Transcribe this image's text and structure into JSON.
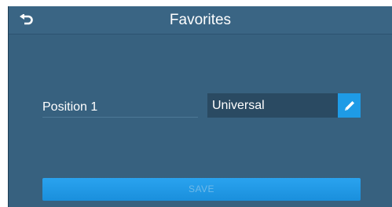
{
  "header": {
    "title": "Favorites",
    "back_icon": "back-arrow-icon"
  },
  "form": {
    "position_label": "Position 1",
    "selected_value": "Universal",
    "edit_icon": "pencil-icon"
  },
  "footer": {
    "save_label": "SAVE",
    "save_enabled": false
  },
  "colors": {
    "background": "#37617f",
    "accent": "#1e9be6",
    "field_background": "#2a4a62"
  }
}
